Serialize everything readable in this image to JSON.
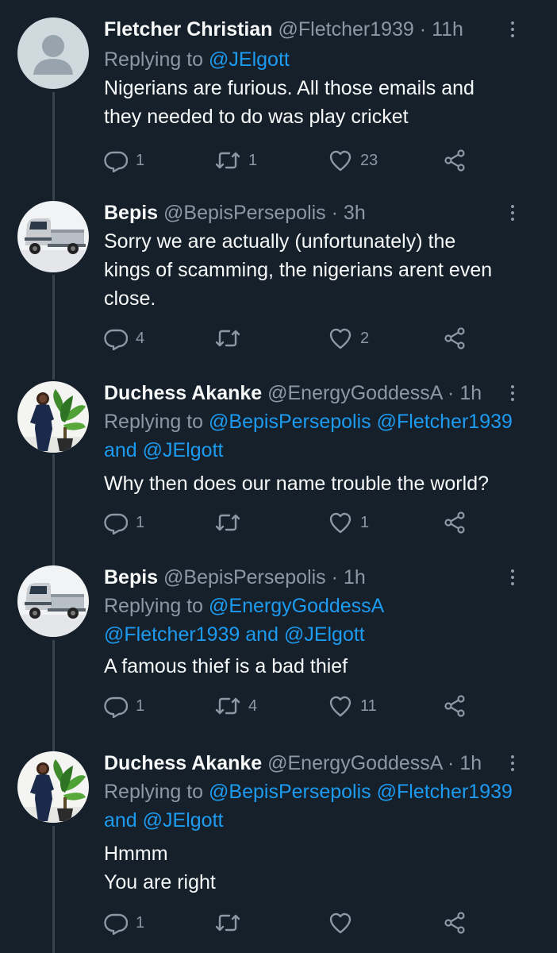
{
  "theme": {
    "background": "#15202b",
    "text": "#f7f9f9",
    "secondary": "#8b98a5",
    "accent": "#1d9bf0",
    "line": "#38444d"
  },
  "tweets": [
    {
      "name": "Fletcher Christian",
      "handle": "@Fletcher1939",
      "dot": "·",
      "time": "11h",
      "replying_prefix": "Replying to ",
      "mentions": [
        "@JElgott"
      ],
      "and_word": "",
      "text": "Nigerians are furious. All those emails and\nthey needed to do was play cricket",
      "replies": "1",
      "retweets": "1",
      "likes": "23",
      "avatar": "default-avatar-icon"
    },
    {
      "name": "Bepis",
      "handle": "@BepisPersepolis",
      "dot": "·",
      "time": "3h",
      "text": "Sorry we are actually (unfortunately) the\nkings of scamming, the nigerians arent even\nclose.",
      "replies": "4",
      "retweets": "",
      "likes": "2",
      "avatar": "truck-avatar-icon"
    },
    {
      "name": "Duchess Akanke",
      "handle": "@EnergyGoddessA",
      "dot": "·",
      "time": "1h",
      "replying_prefix": "Replying to ",
      "mentions": [
        "@BepisPersepolis",
        "@Fletcher1939",
        "@JElgott"
      ],
      "and_word": "and",
      "text": "Why then does our name trouble the world?",
      "replies": "1",
      "retweets": "",
      "likes": "1",
      "avatar": "woman-plant-avatar-icon"
    },
    {
      "name": "Bepis",
      "handle": "@BepisPersepolis",
      "dot": "·",
      "time": "1h",
      "replying_prefix": "Replying to ",
      "mentions": [
        "@EnergyGoddessA",
        "@Fletcher1939",
        "@JElgott"
      ],
      "and_word": "and",
      "text": "A famous thief is a bad thief",
      "replies": "1",
      "retweets": "4",
      "likes": "11",
      "avatar": "truck-avatar-icon"
    },
    {
      "name": "Duchess Akanke",
      "handle": "@EnergyGoddessA",
      "dot": "·",
      "time": "1h",
      "replying_prefix": "Replying to ",
      "mentions": [
        "@BepisPersepolis",
        "@Fletcher1939",
        "@JElgott"
      ],
      "and_word": "and",
      "text": "Hmmm\nYou are right",
      "replies": "1",
      "retweets": "",
      "likes": "",
      "avatar": "woman-plant-avatar-icon"
    }
  ]
}
